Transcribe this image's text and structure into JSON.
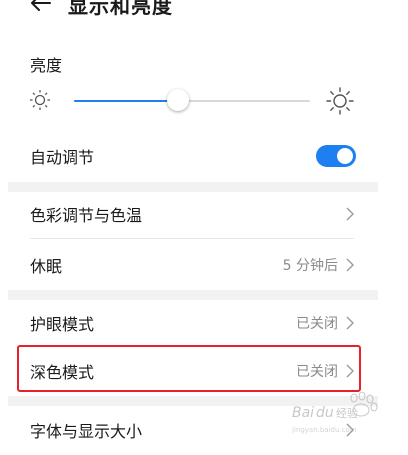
{
  "header": {
    "title": "显示和亮度"
  },
  "brightness": {
    "label": "亮度",
    "level": 0.44
  },
  "auto_adjust": {
    "label": "自动调节",
    "enabled": true
  },
  "settings": [
    {
      "label": "色彩调节与色温",
      "value": ""
    },
    {
      "label": "休眠",
      "value": "5 分钟后"
    },
    {
      "label": "护眼模式",
      "value": "已关闭"
    },
    {
      "label": "深色模式",
      "value": "已关闭"
    },
    {
      "label": "字体与显示大小",
      "value": ""
    }
  ],
  "watermark": {
    "text": "Baidu 经验"
  },
  "colors": {
    "accent": "#1e7ff0",
    "highlight": "#e8202a"
  }
}
